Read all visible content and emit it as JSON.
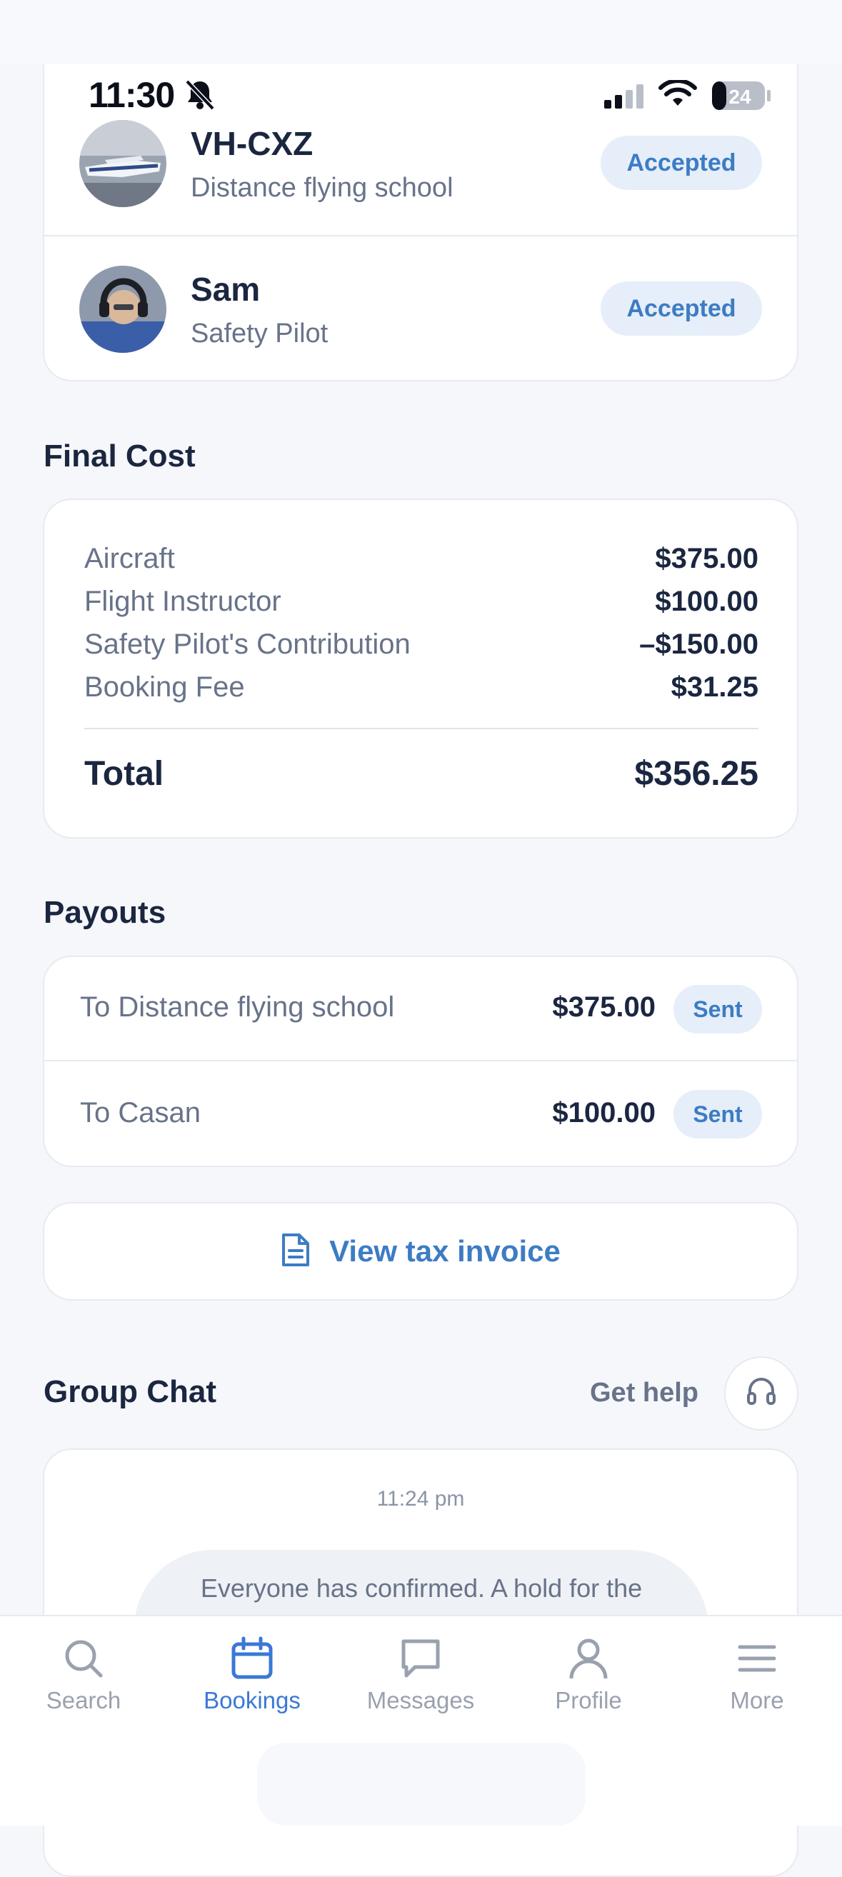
{
  "status_bar": {
    "time": "11:30",
    "battery": "24"
  },
  "participants": [
    {
      "name": "VH-CXZ",
      "role": "Distance flying school",
      "status": "Accepted"
    },
    {
      "name": "Sam",
      "role": "Safety Pilot",
      "status": "Accepted"
    }
  ],
  "final_cost": {
    "title": "Final Cost",
    "items": [
      {
        "label": "Aircraft",
        "value": "$375.00"
      },
      {
        "label": "Flight Instructor",
        "value": "$100.00"
      },
      {
        "label": "Safety Pilot's Contribution",
        "value": "–$150.00"
      },
      {
        "label": "Booking Fee",
        "value": "$31.25"
      }
    ],
    "total_label": "Total",
    "total_value": "$356.25"
  },
  "payouts": {
    "title": "Payouts",
    "items": [
      {
        "label": "To Distance flying school",
        "value": "$375.00",
        "status": "Sent"
      },
      {
        "label": "To Casan",
        "value": "$100.00",
        "status": "Sent"
      }
    ]
  },
  "invoice": {
    "label": "View tax invoice"
  },
  "group_chat": {
    "title": "Group Chat",
    "help_label": "Get help",
    "timestamp": "11:24 pm",
    "message": "Everyone has confirmed. A hold for the estimated amount is placed on the pilot's card."
  },
  "tabbar": {
    "tabs": [
      {
        "label": "Search",
        "icon": "search-icon"
      },
      {
        "label": "Bookings",
        "icon": "calendar-icon"
      },
      {
        "label": "Messages",
        "icon": "message-icon"
      },
      {
        "label": "Profile",
        "icon": "person-icon"
      },
      {
        "label": "More",
        "icon": "menu-icon"
      }
    ],
    "active_color": "#3b78d6",
    "inactive_color": "#9aa1ae"
  }
}
